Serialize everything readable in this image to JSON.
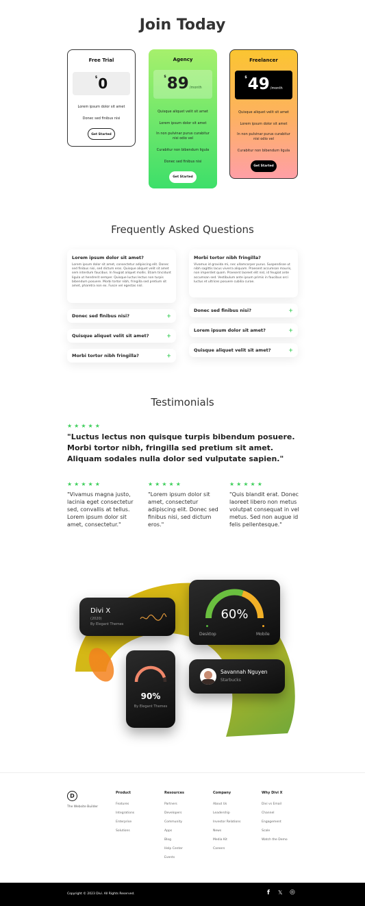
{
  "pricing": {
    "heading": "Join Today",
    "plans": [
      {
        "name": "Free Trial",
        "currency": "$",
        "price": "0",
        "period": "",
        "features": [
          "Lorem ipsum dolor sit amet",
          "Donec sed finibus nisi"
        ],
        "cta": "Get Started"
      },
      {
        "name": "Agency",
        "currency": "$",
        "price": "89",
        "period": "/month",
        "features": [
          "Quisque aliquet velit sit amet",
          "Lorem ipsum dolor sit amet",
          "In non pulvinar purus curabitur nisi odio vel",
          "Curabitur non bibendum ligula",
          "Donec sed finibus nisi"
        ],
        "cta": "Get Started"
      },
      {
        "name": "Freelancer",
        "currency": "$",
        "price": "49",
        "period": "/month",
        "features": [
          "Quisque aliquet velit sit amet",
          "Lorem ipsum dolor sit amet",
          "In non pulvinar purus curabitur nisi odio vel",
          "Curabitur non bibendum ligula"
        ],
        "cta": "Get Started"
      }
    ]
  },
  "faq": {
    "heading": "Frequently Asked Questions",
    "left": [
      {
        "q": "Lorem ipsum dolor sit amet?",
        "a": "Lorem ipsum dolor sit amet, consectetur adipiscing elit. Donec sed finibus nisi, sed dictum eros. Quisque aliquet velit sit amet sem interdum faucibus. In feugiat aliquet mollis. Etiam tincidunt ligula ut hendrerit semper. Quisque luctus lectus non turpis bibendum posuere. Morbi tortor nibh, fringilla sed pretium sit amet, pharetra non ex. Fusce vel egestas nisl."
      },
      {
        "q": "Donec sed finibus nisi?"
      },
      {
        "q": "Quisque aliquet velit sit amet?"
      },
      {
        "q": "Morbi tortor nibh fringilla?"
      }
    ],
    "right": [
      {
        "q": "Morbi tortor nibh fringilla?",
        "a": "Vivamus id gravida mi, nec ullamcorper purus. Suspendisse ut nibh sagittis lacus viverra aliquam. Praesent accumsan mauris, non imperdiet quam. Praesent laoreet elit nisl, id feugiat ante accumsan sed. Vestibulum ante ipsum primis in faucibus orci luctus et ultrices posuere cubilia curae."
      },
      {
        "q": "Donec sed finibus nisi?"
      },
      {
        "q": "Lorem ipsum dolor sit amet?"
      },
      {
        "q": "Quisque aliquet velit sit amet?"
      }
    ],
    "plus": "+"
  },
  "testimonials": {
    "heading": "Testimonials",
    "stars": "★★★★★",
    "main": "\"Luctus lectus non quisque turpis bibendum posuere. Morbi tortor nibh, fringilla sed pretium sit amet. Aliquam sodales nulla dolor sed vulputate sapien.\"",
    "items": [
      "\"Vivamus magna justo, lacinia eget consectetur sed, convallis at tellus. Lorem ipsum dolor sit amet, consectetur.\"",
      "\"Lorem ipsum dolor sit amet, consectetur adipiscing elit. Donec sed finibus nisi, sed dictum eros.\"",
      "\"Quis blandit erat. Donec laoreet libero non metus volutpat consequat in vel metus. Sed non augue id felis pellentesque.\""
    ]
  },
  "illustration": {
    "divi_title": "Divi X",
    "divi_year": "(2020)",
    "divi_by": "By Elegant Themes",
    "gauge_value": "60%",
    "gauge_fraction": 0.6,
    "gauge_left": "Desktop",
    "gauge_right": "Mobile",
    "ring_value": "90%",
    "ring_fraction": 0.9,
    "ring_by": "By Elegant Themes",
    "user_name": "Savannah Nguyen",
    "user_company": "Starbucks"
  },
  "footer": {
    "logo_letter": "D",
    "tagline": "The Website Builder",
    "columns": [
      {
        "title": "Product",
        "links": [
          "Features",
          "Integrations",
          "Enterprise",
          "Solutions"
        ]
      },
      {
        "title": "Resources",
        "links": [
          "Partners",
          "Developers",
          "Community",
          "Apps",
          "Blog",
          "Help Center",
          "Events"
        ]
      },
      {
        "title": "Company",
        "links": [
          "About Us",
          "Leadership",
          "Investor Relations",
          "News",
          "Media Kit",
          "Careers"
        ]
      },
      {
        "title": "Why Divi X",
        "links": [
          "Divi vs Email",
          "Channel",
          "Engagement",
          "Scale",
          "Watch the Demo"
        ]
      }
    ],
    "copyright": "Copyright © 2023 Divi. All Rights Reserved.",
    "social": [
      "f",
      "𝕏",
      "◎"
    ]
  },
  "colors": {
    "accent_green": "#3ecf5b",
    "accent_orange": "#f4b13c"
  }
}
